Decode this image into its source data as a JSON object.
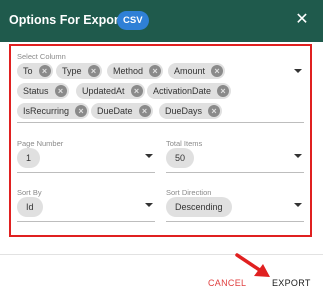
{
  "header": {
    "title": "Options For Export To",
    "format_badge": "CSV",
    "close_glyph": "✕"
  },
  "select_column": {
    "label": "Select Column",
    "chips": [
      {
        "label": "To"
      },
      {
        "label": "Type"
      },
      {
        "label": "Method"
      },
      {
        "label": "Amount"
      },
      {
        "label": "Status"
      },
      {
        "label": "UpdatedAt"
      },
      {
        "label": "ActivationDate"
      },
      {
        "label": "IsRecurring"
      },
      {
        "label": "DueDate"
      },
      {
        "label": "DueDays"
      }
    ],
    "remove_glyph": "×"
  },
  "page_number": {
    "label": "Page Number",
    "value": "1"
  },
  "total_items": {
    "label": "Total Items",
    "value": "50"
  },
  "sort_by": {
    "label": "Sort By",
    "value": "Id"
  },
  "sort_direction": {
    "label": "Sort Direction",
    "value": "Descending"
  },
  "footer": {
    "cancel_label": "CANCEL",
    "export_label": "EXPORT"
  },
  "colors": {
    "header_bg": "#1f5a4c",
    "badge_bg": "#2f80d6",
    "highlight_border": "#e02020",
    "cancel_text": "#e04040",
    "annotation_arrow": "#e02020"
  },
  "icons": [
    "close-icon",
    "chip-remove-icon",
    "dropdown-caret-icon",
    "annotation-arrow-icon"
  ]
}
